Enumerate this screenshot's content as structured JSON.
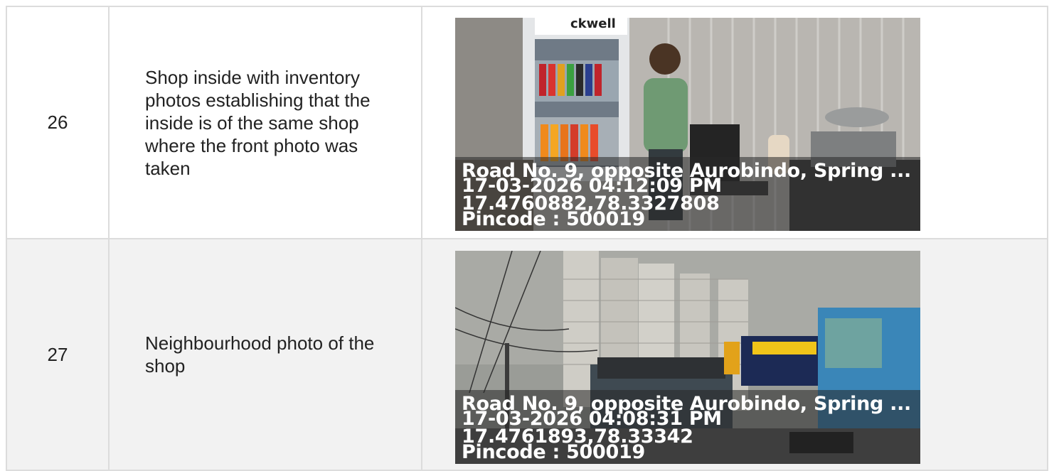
{
  "rows": [
    {
      "number": "26",
      "description": "Shop inside with inventory photos establishing that the inside is of the same shop where the front photo was taken",
      "photo": {
        "sign_text": "ckwell",
        "address": "Road No. 9, opposite Aurobindo, Spring ...",
        "datetime": "17-03-2026 04:12:09 PM",
        "coordinates": "17.4760882,78.3327808",
        "pincode": "Pincode : 500019"
      }
    },
    {
      "number": "27",
      "description": "Neighbourhood photo of the shop",
      "photo": {
        "address": "Road No. 9, opposite Aurobindo, Spring ...",
        "datetime": "17-03-2026 04:08:31 PM",
        "coordinates": "17.4761893,78.33342",
        "pincode": "Pincode : 500019"
      }
    }
  ]
}
